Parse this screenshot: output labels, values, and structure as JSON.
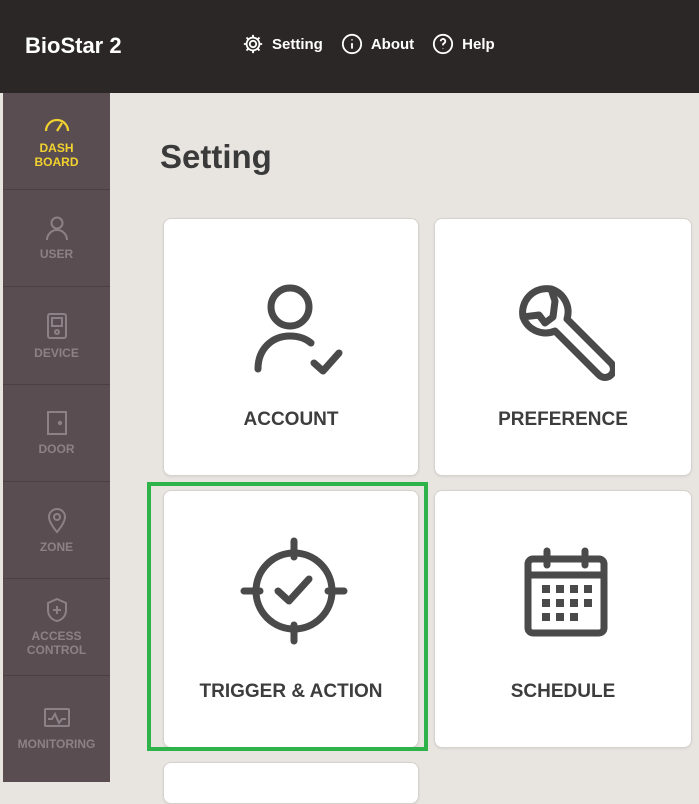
{
  "app": {
    "title": "BioStar 2"
  },
  "topnav": [
    {
      "label": "Setting",
      "icon": "gear-icon"
    },
    {
      "label": "About",
      "icon": "info-icon"
    },
    {
      "label": "Help",
      "icon": "help-icon"
    }
  ],
  "sidebar": {
    "items": [
      {
        "label": "DASH\nBOARD",
        "icon": "dashboard-gauge-icon",
        "active": true
      },
      {
        "label": "USER",
        "icon": "user-icon"
      },
      {
        "label": "DEVICE",
        "icon": "device-icon"
      },
      {
        "label": "DOOR",
        "icon": "door-icon"
      },
      {
        "label": "ZONE",
        "icon": "zone-pin-icon"
      },
      {
        "label": "ACCESS\nCONTROL",
        "icon": "access-control-icon"
      },
      {
        "label": "MONITORING",
        "icon": "monitoring-icon"
      }
    ]
  },
  "main": {
    "title": "Setting",
    "cards": [
      {
        "label": "ACCOUNT",
        "icon": "account-user-check-icon"
      },
      {
        "label": "PREFERENCE",
        "icon": "wrench-icon"
      },
      {
        "label": "TRIGGER & ACTION",
        "icon": "crosshair-check-icon",
        "highlighted": true
      },
      {
        "label": "SCHEDULE",
        "icon": "calendar-icon"
      }
    ]
  },
  "colors": {
    "topbar": "#2c2727",
    "sidebar": "#5a4d51",
    "active": "#f2d22e",
    "highlight": "#2eb34a",
    "background": "#e8e5e1"
  }
}
